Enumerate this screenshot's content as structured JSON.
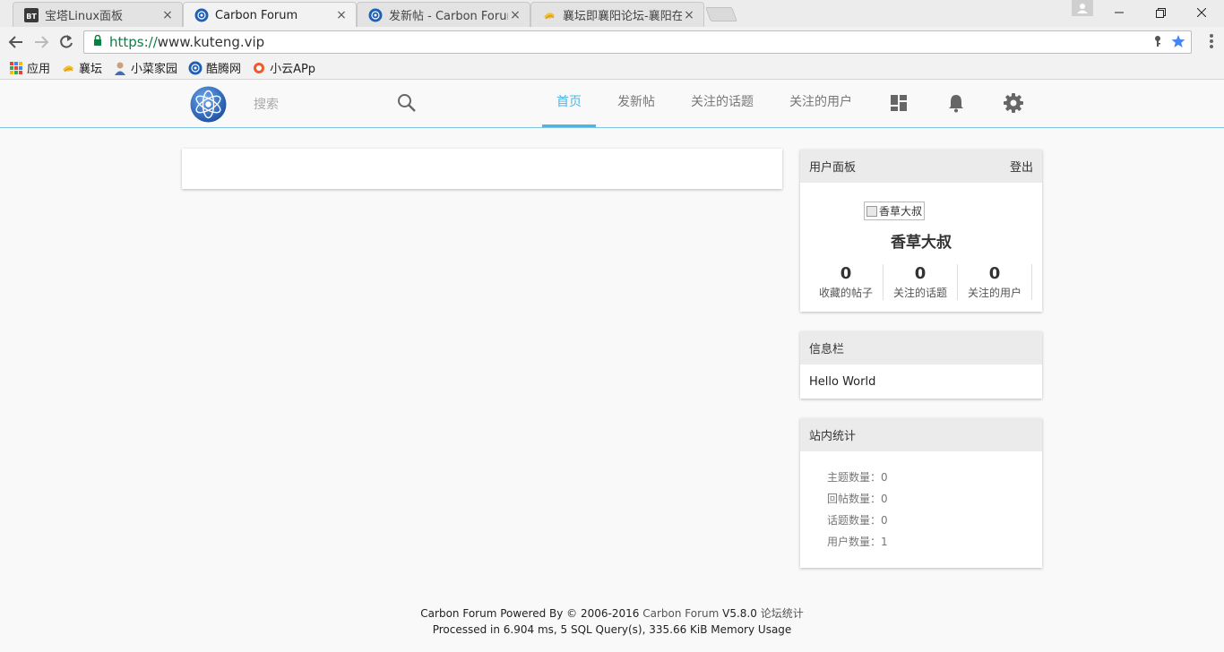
{
  "browser": {
    "tabs": [
      {
        "title": "宝塔Linux面板",
        "favicon": "bt-icon"
      },
      {
        "title": "Carbon Forum",
        "favicon": "carbon-forum-icon"
      },
      {
        "title": "发新帖 - Carbon Forum",
        "favicon": "carbon-forum-icon"
      },
      {
        "title": "襄坛即襄阳论坛-襄阳在线",
        "favicon": "xiangtan-icon"
      }
    ],
    "close_glyph": "×",
    "url_scheme": "https://",
    "url_host": "www.kuteng.vip",
    "bookmarks": [
      {
        "label": "应用",
        "icon": "apps-grid-icon"
      },
      {
        "label": "襄坛",
        "icon": "xiangtan-icon"
      },
      {
        "label": "小菜家园",
        "icon": "person-icon"
      },
      {
        "label": "酷腾网",
        "icon": "carbon-forum-icon"
      },
      {
        "label": "小云APp",
        "icon": "cloud-icon"
      }
    ]
  },
  "header": {
    "search_placeholder": "搜索",
    "nav": [
      {
        "label": "首页",
        "active": true
      },
      {
        "label": "发新帖",
        "active": false
      },
      {
        "label": "关注的话题",
        "active": false
      },
      {
        "label": "关注的用户",
        "active": false
      }
    ],
    "accent_color": "#4cb6e8"
  },
  "user_panel": {
    "title": "用户面板",
    "logout": "登出",
    "avatar_alt": "香草大叔",
    "username": "香草大叔",
    "stats": [
      {
        "value": "0",
        "label": "收藏的帖子"
      },
      {
        "value": "0",
        "label": "关注的话题"
      },
      {
        "value": "0",
        "label": "关注的用户"
      }
    ]
  },
  "info_panel": {
    "title": "信息栏",
    "content": "Hello World"
  },
  "site_stats": {
    "title": "站内统计",
    "items": [
      "主题数量：0",
      "回帖数量：0",
      "话题数量：0",
      "用户数量：1"
    ]
  },
  "footer": {
    "line1_prefix": "Carbon Forum Powered By © 2006-2016 ",
    "line1_link": "Carbon Forum",
    "line1_version": " V5.8.0 ",
    "line1_stats_link": "论坛统计",
    "line2": "Processed in 6.904 ms, 5 SQL Query(s), 335.66 KiB Memory Usage"
  }
}
